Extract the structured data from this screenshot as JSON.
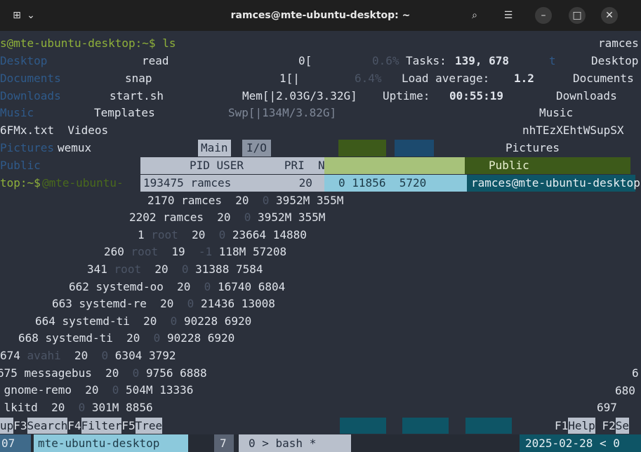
{
  "window": {
    "title": "ramces@mte-ubuntu-desktop: ~"
  },
  "terminal_left": {
    "prompt_line": "s@mte-ubuntu-desktop:~$ ls",
    "ls_faded": [
      "Desktop",
      "Documents",
      "Downloads",
      "Music",
      "Pictures",
      "Public"
    ],
    "ls_files": [
      "read",
      "snap",
      "start.sh",
      "Templates",
      "6FMx.txt  Videos",
      "wemux"
    ],
    "prompt_end": "top:~$",
    "ghost_prompt": "@mte-ubuntu-"
  },
  "terminal_right": {
    "lines": [
      "ramces",
      "Desktop",
      "Documents",
      "Downloads",
      "Music",
      "nhTEzXEhtWSupSX",
      "Pictures",
      "Public",
      "ramces@mte-ubuntu-desktop"
    ]
  },
  "htop": {
    "cpu0": "0[",
    "cpu0_val": "0.6%",
    "cpu1": "1[|",
    "cpu1_val": "6.4%",
    "mem": "Mem[|2.03G/3.32G]",
    "swp": "Swp[|134M/3.82G]",
    "tasks_label": "Tasks:",
    "tasks_val": "139, 678",
    "tasks_suffix": "t",
    "load_label": "Load average:",
    "load_val": "1.2",
    "uptime_label": "Uptime:",
    "uptime_val": "00:55:19",
    "tabs": [
      "Main",
      "I/O"
    ],
    "header": "PID USER      PRI  NI  VIRT   RES",
    "rows": [
      {
        "pid": "193475",
        "user": "ramces",
        "pri": "20",
        "ni": "0",
        "virt": "11856",
        "res": "5720"
      },
      {
        "pid": "2170",
        "user": "ramces",
        "pri": "20",
        "ni": "0",
        "virt": "3952M",
        "res": "355M"
      },
      {
        "pid": "2202",
        "user": "ramces",
        "pri": "20",
        "ni": "0",
        "virt": "3952M",
        "res": "355M"
      },
      {
        "pid": "1",
        "user": "root",
        "pri": "20",
        "ni": "0",
        "virt": "23664",
        "res": "14880"
      },
      {
        "pid": "260",
        "user": "root",
        "pri": "19",
        "ni": "-1",
        "virt": "118M",
        "res": "57208"
      },
      {
        "pid": "341",
        "user": "root",
        "pri": "20",
        "ni": "0",
        "virt": "31388",
        "res": "7584"
      },
      {
        "pid": "662",
        "user": "systemd-oo",
        "pri": "20",
        "ni": "0",
        "virt": "16740",
        "res": "6804"
      },
      {
        "pid": "663",
        "user": "systemd-re",
        "pri": "20",
        "ni": "0",
        "virt": "21436",
        "res": "13008"
      },
      {
        "pid": "664",
        "user": "systemd-ti",
        "pri": "20",
        "ni": "0",
        "virt": "90228",
        "res": "6920"
      },
      {
        "pid": "668",
        "user": "systemd-ti",
        "pri": "20",
        "ni": "0",
        "virt": "90228",
        "res": "6920"
      },
      {
        "pid": "674",
        "user": "avahi",
        "pri": "20",
        "ni": "0",
        "virt": "6304",
        "res": "3792"
      },
      {
        "pid": "675",
        "user": "messagebus",
        "pri": "20",
        "ni": "0",
        "virt": "9756",
        "res": "6888"
      },
      {
        "pid": "",
        "user": "gnome-remo",
        "pri": "20",
        "ni": "0",
        "virt": "504M",
        "res": "13336"
      },
      {
        "pid": "",
        "user": "lkitd",
        "pri": "20",
        "ni": "0",
        "virt": "301M",
        "res": "8856"
      }
    ],
    "right_pids": [
      "6",
      "680",
      "697"
    ],
    "fkeys": [
      {
        "key": "",
        "label": "up"
      },
      {
        "key": "F3",
        "label": "Search"
      },
      {
        "key": "F4",
        "label": "Filter"
      },
      {
        "key": "F5",
        "label": "Tree"
      },
      {
        "key": "F1",
        "label": "Help"
      },
      {
        "key": "F2",
        "label": "Se"
      }
    ]
  },
  "tmux": {
    "session": "07",
    "host": "mte-ubuntu-desktop",
    "window_num": "7",
    "window": "0 > bash *",
    "date": "2025-02-28",
    "time_frag": "< 0"
  }
}
